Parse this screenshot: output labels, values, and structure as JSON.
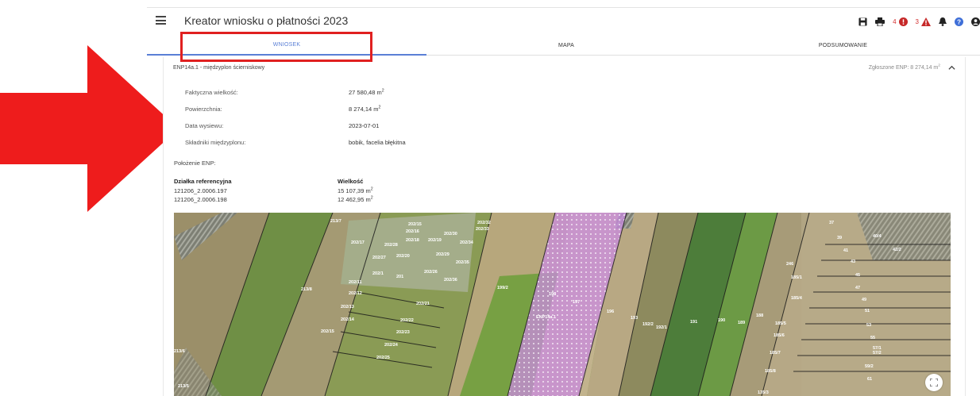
{
  "header": {
    "title": "Kreator wniosku o płatności 2023",
    "error_count": "4",
    "warning_count": "3"
  },
  "tabs": [
    {
      "label": "WNIOSEK",
      "active": true
    },
    {
      "label": "MAPA",
      "active": false
    },
    {
      "label": "PODSUMOWANIE",
      "active": false
    }
  ],
  "panel": {
    "title": "ENP14a.1 - międzyplon ścierniskowy",
    "declared_label": "Zgłoszone ENP: 8 274,14 m",
    "declared_sup": "2",
    "fields": [
      {
        "label": "Faktyczna wielkość:",
        "value": "27 580,48 m",
        "unit_sup": "2"
      },
      {
        "label": "Powierzchnia:",
        "value": "8 274,14 m",
        "unit_sup": "2"
      },
      {
        "label": "Data wysiewu:",
        "value": "2023-07-01",
        "unit_sup": ""
      },
      {
        "label": "Składniki międzyplonu:",
        "value": "bobik, facelia błękitna",
        "unit_sup": ""
      }
    ],
    "location_title": "Położenie ENP:",
    "table": {
      "headers": [
        "Działka referencyjna",
        "Wielkość"
      ],
      "rows": [
        {
          "parcel": "121206_2.0006.197",
          "size": "15 107,39 m",
          "unit_sup": "2"
        },
        {
          "parcel": "121206_2.0006.198",
          "size": "12 462,95 m",
          "unit_sup": "2"
        }
      ]
    }
  },
  "map": {
    "labels": [
      "213/7",
      "202/15",
      "202/16",
      "202/32",
      "202/33",
      "202/17",
      "202/18",
      "202/19",
      "202/30",
      "202/34",
      "202/28",
      "202/29",
      "202/20",
      "202/27",
      "202/35",
      "202/26",
      "202/36",
      "202/1",
      "201",
      "202/11",
      "213/8",
      "202/12",
      "202/13",
      "202/21",
      "213/6",
      "202/14",
      "202/22",
      "202/15",
      "202/23",
      "202/24",
      "202/25",
      "213/5",
      "199/2",
      "198",
      "197",
      "ENP14a.1",
      "196",
      "193",
      "192/2",
      "192/1",
      "191",
      "190",
      "189",
      "188",
      "37",
      "39",
      "40/4",
      "41",
      "42/2",
      "43",
      "45",
      "246",
      "185/1",
      "47",
      "185/4",
      "49",
      "51",
      "53",
      "185/5",
      "185/6",
      "55",
      "57/1",
      "57/2",
      "185/7",
      "59/2",
      "61",
      "185/8",
      "135/3"
    ],
    "colors": {
      "enp_overlay": "#c98be0",
      "parcel_line": "#1a1a1a",
      "label": "#ffffff"
    }
  },
  "colors": {
    "accent": "#5a7fd6",
    "highlight": "#e02020",
    "error": "#d32f2f",
    "help": "#3f6fd8"
  },
  "icons": [
    "menu-icon",
    "save-icon",
    "print-icon",
    "error-icon",
    "warning-icon",
    "bell-icon",
    "help-icon",
    "account-icon",
    "chevron-up-icon",
    "fullscreen-icon"
  ]
}
